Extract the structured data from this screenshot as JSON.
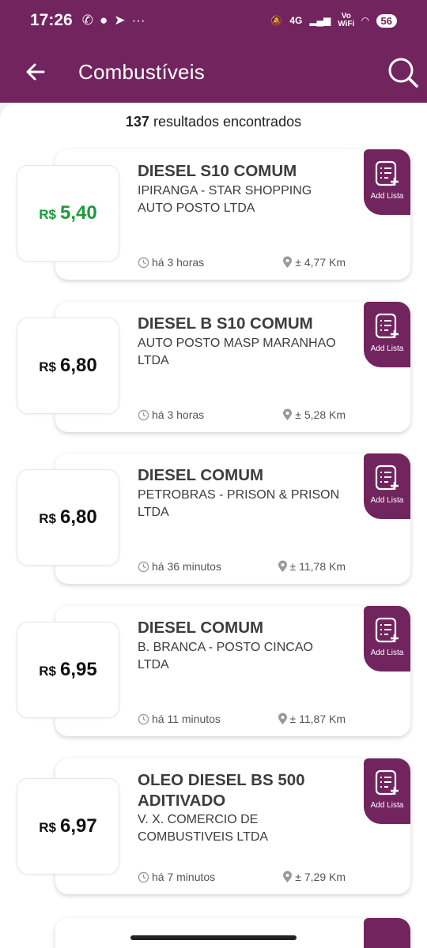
{
  "status": {
    "time": "17:26",
    "network": "4G",
    "vowifi_top": "Vo",
    "vowifi_bottom": "WiFi",
    "battery": "56"
  },
  "appbar": {
    "title": "Combustíveis",
    "back_icon": "arrow-left-icon",
    "search_icon": "search-icon"
  },
  "results": {
    "count": "137",
    "label": "resultados encontrados"
  },
  "currency": "R$",
  "add_label": "Add Lista",
  "items": [
    {
      "name": "DIESEL S10 COMUM",
      "station": "IPIRANGA - STAR SHOPPING AUTO POSTO LTDA",
      "price": "5,40",
      "time": "há 3 horas",
      "distance": "± 4,77 Km",
      "highlight": true
    },
    {
      "name": "DIESEL B S10 COMUM",
      "station": "AUTO POSTO MASP MARANHAO LTDA",
      "price": "6,80",
      "time": "há 3 horas",
      "distance": "± 5,28 Km",
      "highlight": false
    },
    {
      "name": "DIESEL COMUM",
      "station": "PETROBRAS - PRISON & PRISON LTDA",
      "price": "6,80",
      "time": "há 36 minutos",
      "distance": "± 11,78 Km",
      "highlight": false
    },
    {
      "name": "DIESEL COMUM",
      "station": "B. BRANCA - POSTO CINCAO LTDA",
      "price": "6,95",
      "time": "há 11 minutos",
      "distance": "± 11,87 Km",
      "highlight": false
    },
    {
      "name": "OLEO DIESEL BS 500 ADITIVADO",
      "station": "V. X. COMERCIO DE COMBUSTIVEIS LTDA",
      "price": "6,97",
      "time": "há 7 minutos",
      "distance": "± 7,29 Km",
      "highlight": false
    }
  ],
  "colors": {
    "brand": "#72245f",
    "best_price": "#1c9a3b"
  }
}
